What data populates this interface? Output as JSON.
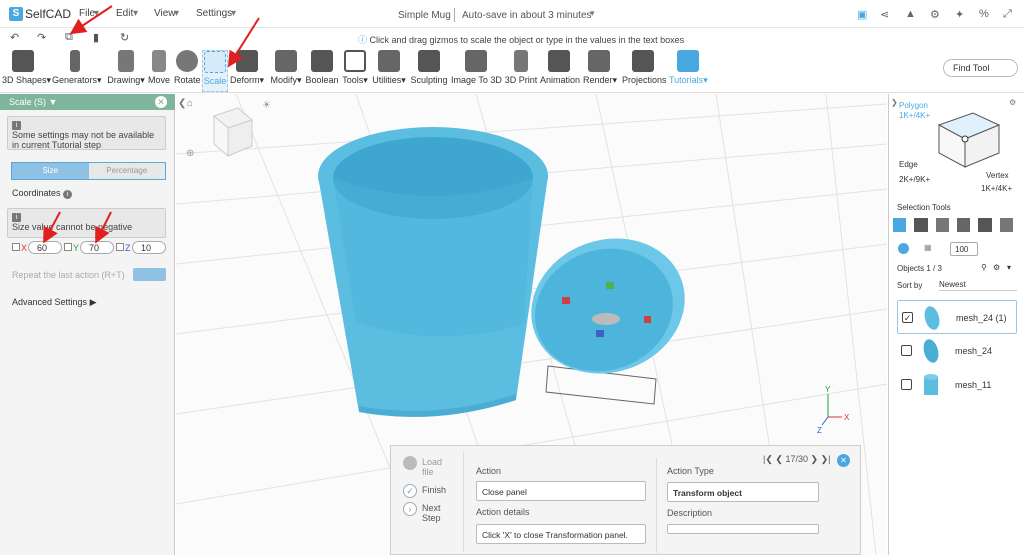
{
  "app": {
    "name": "SelfCAD"
  },
  "topbar": {
    "menus": [
      "File",
      "Edit",
      "View",
      "Settings"
    ],
    "doc_title": "Simple Mug",
    "autosave": "Auto-save in about 3 minutes"
  },
  "hint": "Click and drag gizmos to scale the object or type in the values in the text boxes",
  "toolbar": {
    "tools": [
      "3D Shapes",
      "Generators",
      "Drawing",
      "Move",
      "Rotate",
      "Scale",
      "Deform",
      "Modify",
      "Boolean",
      "Tools",
      "Utilities",
      "Sculpting",
      "Image To 3D",
      "3D Print",
      "Animation",
      "Render",
      "Projections",
      "Tutorials"
    ],
    "find_tool": "Find Tool"
  },
  "scale_panel": {
    "title": "Scale (S)",
    "note": "Some settings may not be available in current Tutorial step",
    "toggle": {
      "size": "Size",
      "percentage": "Percentage"
    },
    "coordinates_label": "Coordinates",
    "warning": "Size value cannot be negative",
    "x_label": "X",
    "x": "60",
    "y_label": "Y",
    "y": "70",
    "z_label": "Z",
    "z": "10",
    "repeat_label": "Repeat the last action (R+T)",
    "advanced": "Advanced Settings"
  },
  "right_panel": {
    "polygon": "Polygon",
    "polygon_count": "1K+/4K+",
    "edge": "Edge",
    "edge_count": "2K+/9K+",
    "vertex": "Vertex",
    "vertex_count": "1K+/4K+",
    "selection_tools": "Selection Tools",
    "size_value": "100",
    "objects_count": "Objects 1 / 3",
    "sort_by": "Sort by",
    "sort_value": "Newest",
    "objects": [
      {
        "name": "mesh_24 (1)",
        "checked": "✓"
      },
      {
        "name": "mesh_24",
        "checked": ""
      },
      {
        "name": "mesh_11",
        "checked": ""
      }
    ]
  },
  "tutorial": {
    "steps": [
      "Load file",
      "Finish",
      "Next Step"
    ],
    "counter": "17/30",
    "action_label": "Action",
    "action_value": "Close panel",
    "action_details_label": "Action details",
    "action_details_value": "Click 'X' to close Transformation panel.",
    "action_type_label": "Action Type",
    "action_type_value": "Transform object",
    "description_label": "Description"
  },
  "colors": {
    "accent": "#4aa8e0",
    "panel_header": "#7fb59b",
    "mug": "#5bbde0",
    "arrow": "#e02020"
  }
}
